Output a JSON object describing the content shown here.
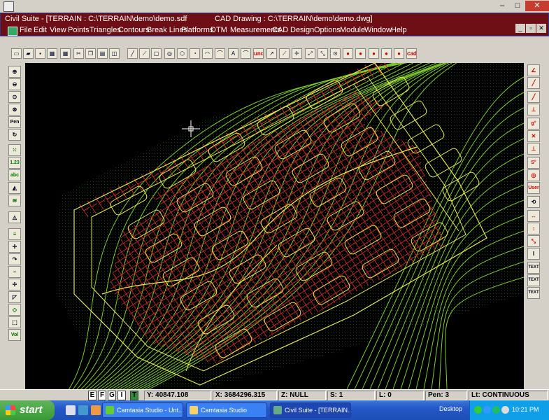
{
  "window": {
    "title": "Civil Suite - [TERRAIN : C:\\TERRAIN\\demo\\demo.sdf",
    "doc_title": "CAD Drawing : C:\\TERRAIN\\demo\\demo.dwg]",
    "minimize": "–",
    "maximize": "□",
    "close": "✕"
  },
  "menu": [
    "File",
    "Edit",
    "View",
    "Points",
    "Triangles",
    "Contours",
    "Break Lines",
    "Platforms",
    "DTM",
    "Measurements",
    "CAD",
    "Design",
    "Options",
    "Module",
    "Window",
    "Help"
  ],
  "mdi_controls": [
    "_",
    "▫",
    "✕"
  ],
  "toolbar_labels": {
    "undo": "undo",
    "cad": "cad",
    "text_a": "A"
  },
  "left_toolbar_labels": {
    "pen": "Pen",
    "num": "1.23",
    "abc": "abc",
    "vol": "Vol"
  },
  "right_toolbar_labels": {
    "user": "User",
    "text": "TEXT",
    "s": "S°",
    "g": "g°"
  },
  "status": {
    "modes": [
      "E",
      "F",
      "G",
      "I",
      "T"
    ],
    "y": "Y: 40847.108",
    "x": "X: 3684296.315",
    "z": "Z: NULL",
    "s": "S: 1",
    "l": "L: 0",
    "pen": "Pen: 3",
    "lt": "Lt: CONTINUOUS"
  },
  "taskbar": {
    "start": "start",
    "tasks": [
      "Camtasia Studio - Unt...",
      "Camtasia Studio",
      "Civil Suite - [TERRAIN..."
    ],
    "desktop": "Desktop",
    "clock": "10:21 PM"
  },
  "colors": {
    "contour_green": "#7fcc2a",
    "road_yellow": "#e8ea52",
    "lot_red": "#d0262a",
    "canvas_bg": "#000000",
    "menubar_bg": "#6d0f14"
  }
}
